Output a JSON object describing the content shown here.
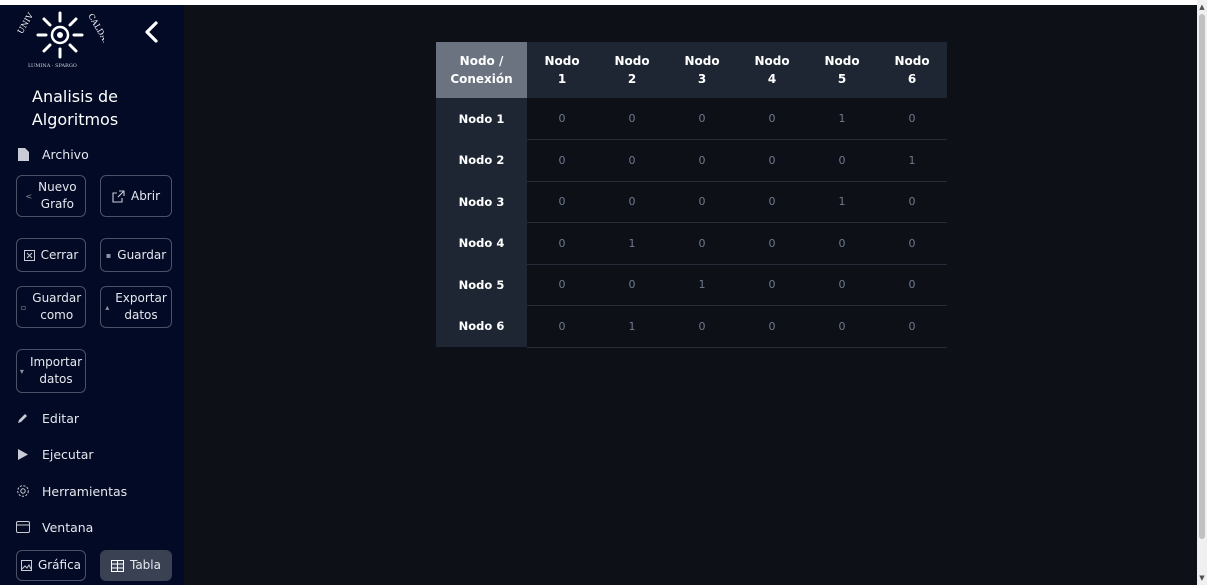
{
  "sidebar": {
    "logo_text": "UNIVERSIDAD DE CALDAS · LUMINA SPARGO",
    "app_title_line1": "Analisis de",
    "app_title_line2": "Algoritmos",
    "archivo": "Archivo",
    "buttons": {
      "nuevo_grafo": [
        "Nuevo",
        "Grafo"
      ],
      "abrir": "Abrir",
      "cerrar": "Cerrar",
      "guardar": "Guardar",
      "guardar_como": [
        "Guardar",
        "como"
      ],
      "exportar": [
        "Exportar",
        "datos"
      ],
      "importar": [
        "Importar",
        "datos"
      ]
    },
    "editar": "Editar",
    "ejecutar": "Ejecutar",
    "herramientas": "Herramientas",
    "ventana": "Ventana",
    "grafica": "Gráfica",
    "tabla": "Tabla"
  },
  "table": {
    "corner": [
      "Nodo /",
      "Conexión"
    ],
    "columns": [
      [
        "Nodo",
        "1"
      ],
      [
        "Nodo",
        "2"
      ],
      [
        "Nodo",
        "3"
      ],
      [
        "Nodo",
        "4"
      ],
      [
        "Nodo",
        "5"
      ],
      [
        "Nodo",
        "6"
      ]
    ],
    "rows": [
      {
        "label": "Nodo 1",
        "values": [
          "0",
          "0",
          "0",
          "0",
          "1",
          "0"
        ]
      },
      {
        "label": "Nodo 2",
        "values": [
          "0",
          "0",
          "0",
          "0",
          "0",
          "1"
        ]
      },
      {
        "label": "Nodo 3",
        "values": [
          "0",
          "0",
          "0",
          "0",
          "1",
          "0"
        ]
      },
      {
        "label": "Nodo 4",
        "values": [
          "0",
          "1",
          "0",
          "0",
          "0",
          "0"
        ]
      },
      {
        "label": "Nodo 5",
        "values": [
          "0",
          "0",
          "1",
          "0",
          "0",
          "0"
        ]
      },
      {
        "label": "Nodo 6",
        "values": [
          "0",
          "1",
          "0",
          "0",
          "0",
          "0"
        ]
      }
    ]
  }
}
